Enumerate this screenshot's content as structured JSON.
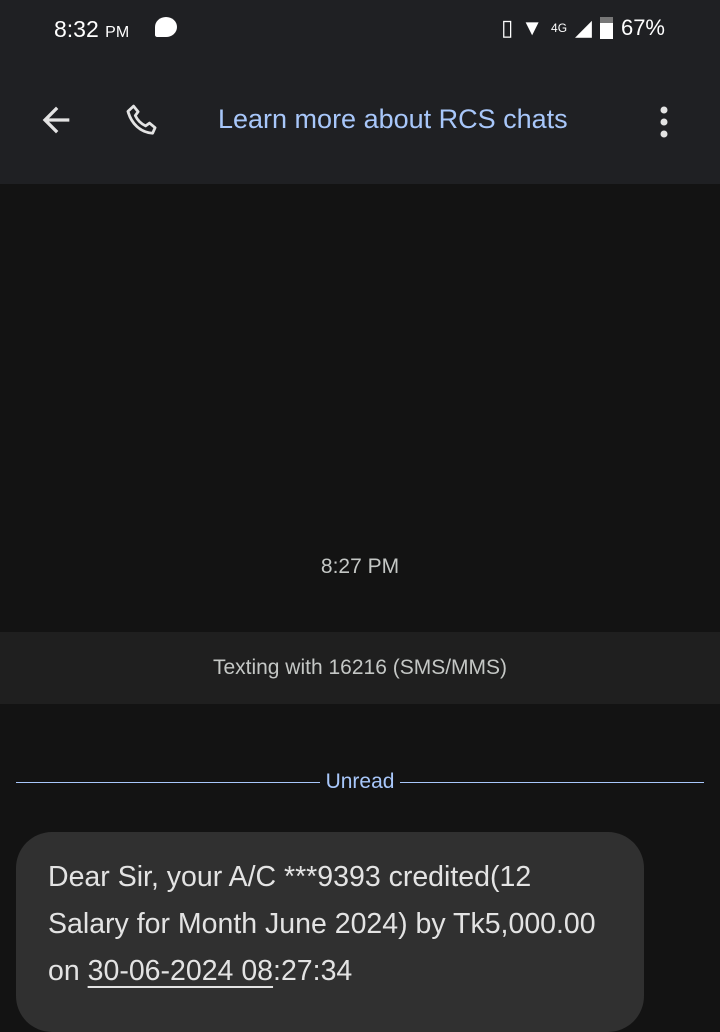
{
  "status_bar": {
    "time": "8:32",
    "ampm": "PM",
    "network": "4G",
    "battery": "67%"
  },
  "app_bar": {
    "rcs_link": "Learn more about RCS chats"
  },
  "conversation": {
    "timestamp": "8:27 PM",
    "texting_with": "Texting with 16216 (SMS/MMS)",
    "unread_label": "Unread",
    "message": {
      "text_before": "Dear Sir, your A/C ***9393 credited(12 Salary for Month June 2024) by Tk5,000.00 on ",
      "linked_datetime": "30-06-2024 08",
      "text_after": ":27:34"
    }
  }
}
